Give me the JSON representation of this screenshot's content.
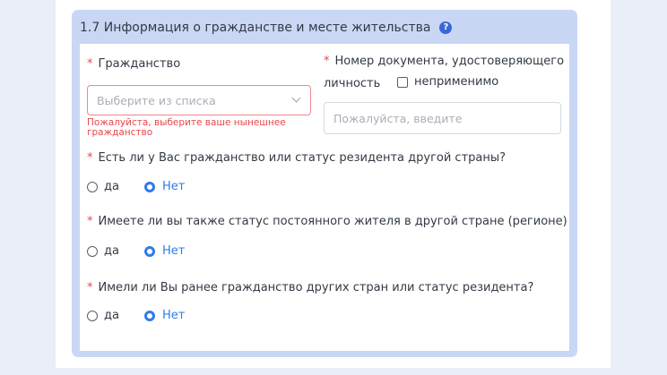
{
  "section": {
    "title": "1.7 Информация о гражданстве и месте жительства",
    "help_icon": "question-circle-icon"
  },
  "citizenship": {
    "required_mark": "*",
    "label": "Гражданство",
    "placeholder": "Выберите из списка",
    "error": "Пожалуйста, выберите ваше нынешнее гражданство"
  },
  "id_document": {
    "required_mark": "*",
    "label_line1": "Номер документа, удостоверяющего",
    "label_line2": "личность",
    "not_applicable_label": "неприменимо",
    "not_applicable_checked": false,
    "placeholder": "Пожалуйста, введите"
  },
  "questions": [
    {
      "required_mark": "*",
      "text": "Есть ли у Вас гражданство или статус резидента другой страны?",
      "yes": "да",
      "no": "Нет",
      "selected": "no"
    },
    {
      "required_mark": "*",
      "text": "Имеете ли вы также статус постоянного жителя в другой стране (регионе)",
      "yes": "да",
      "no": "Нет",
      "selected": "no"
    },
    {
      "required_mark": "*",
      "text": "Имели ли Вы ранее гражданство других стран или статус резидента?",
      "yes": "да",
      "no": "Нет",
      "selected": "no"
    }
  ],
  "colors": {
    "accent": "#2f7ce8",
    "error": "#e8464d",
    "panel": "#c9d7f5"
  }
}
